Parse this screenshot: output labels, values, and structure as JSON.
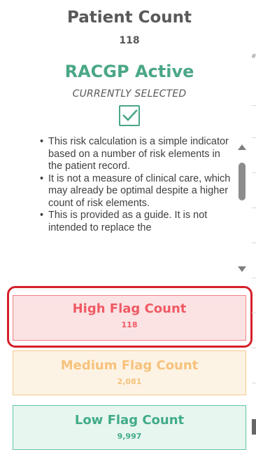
{
  "header": {
    "title": "Patient Count",
    "count": "118"
  },
  "selection": {
    "name": "RACGP Active",
    "status": "CURRENTLY SELECTED",
    "checked": true,
    "check_color": "#4aa785"
  },
  "description": {
    "bullets": [
      "This risk calculation is a simple indicator based on a number of risk elements in the patient record.",
      "It is not a measure of clinical care, which may already be optimal despite a higher count of risk elements.",
      "This is provided as a guide. It is not intended to replace the"
    ]
  },
  "flags": {
    "high": {
      "label": "High Flag Count",
      "value": "118",
      "color": "#f05a64",
      "selected": true
    },
    "medium": {
      "label": "Medium Flag Count",
      "value": "2,081",
      "color": "#f6c27c"
    },
    "low": {
      "label": "Low Flag Count",
      "value": "9,997",
      "color": "#40ac87"
    }
  },
  "right_panel": {
    "column_marker": "#"
  }
}
